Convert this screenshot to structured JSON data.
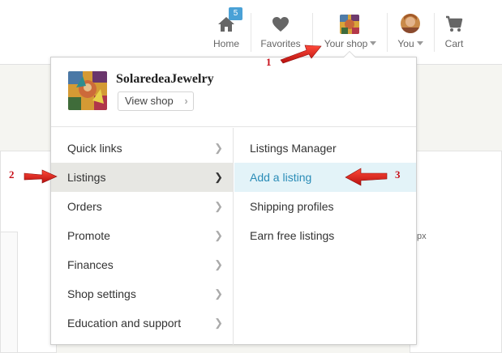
{
  "header": {
    "home": {
      "label": "Home",
      "badge": "5",
      "icon": "home-icon"
    },
    "favorites": {
      "label": "Favorites",
      "icon": "heart-icon"
    },
    "your_shop": {
      "label": "Your shop",
      "icon": "shop-thumbnail"
    },
    "you": {
      "label": "You",
      "icon": "avatar"
    },
    "cart": {
      "label": "Cart",
      "icon": "cart-icon"
    }
  },
  "shop_menu": {
    "shop_name": "SolaredeaJewelry",
    "view_shop_label": "View shop",
    "left_items": [
      {
        "label": "Quick links",
        "active": false
      },
      {
        "label": "Listings",
        "active": true
      },
      {
        "label": "Orders",
        "active": false
      },
      {
        "label": "Promote",
        "active": false
      },
      {
        "label": "Finances",
        "active": false
      },
      {
        "label": "Shop settings",
        "active": false
      },
      {
        "label": "Education and support",
        "active": false
      }
    ],
    "right_items": [
      {
        "label": "Listings Manager",
        "active": false
      },
      {
        "label": "Add a listing",
        "active": true
      },
      {
        "label": "Shipping profiles",
        "active": false
      },
      {
        "label": "Earn free listings",
        "active": false
      }
    ]
  },
  "annotations": {
    "step1": "1",
    "step2": "2",
    "step3": "3"
  },
  "background": {
    "stray_text": "px"
  },
  "colors": {
    "accent": "#2a8cb7",
    "badge": "#4aa1d6",
    "annotation": "#c8101a",
    "active_row": "#e7e7e3",
    "active_sub": "#e3f3f8"
  }
}
